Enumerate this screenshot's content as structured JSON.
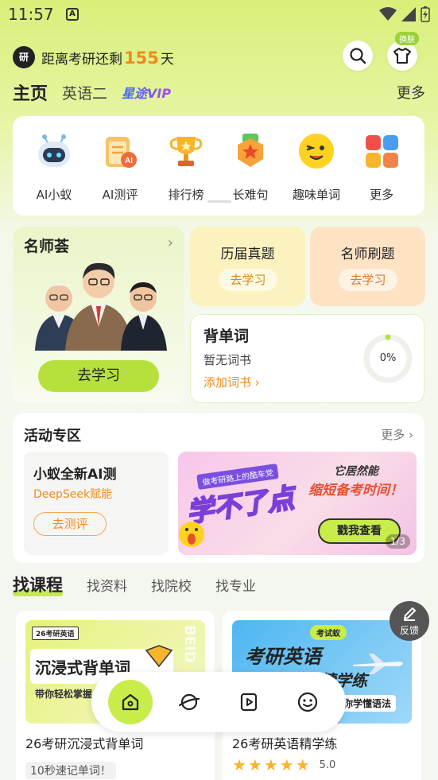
{
  "status_bar": {
    "time": "11:57",
    "badge": "A"
  },
  "header": {
    "logo_text": "研",
    "countdown_prefix": "距离考研还剩",
    "countdown_days": "155",
    "countdown_suffix": "天",
    "skin_label": "换肤"
  },
  "top_tabs": {
    "items": [
      "主页",
      "英语二"
    ],
    "vip_label": "星途VIP",
    "more_label": "更多"
  },
  "tools": [
    {
      "label": "AI小蚁",
      "icon": "robot-icon"
    },
    {
      "label": "AI测评",
      "icon": "ai-clipboard-icon"
    },
    {
      "label": "排行榜",
      "icon": "trophy-icon"
    },
    {
      "label": "长难句",
      "icon": "star-badge-icon"
    },
    {
      "label": "趣味单词",
      "icon": "smiley-icon"
    },
    {
      "label": "更多",
      "icon": "grid-icon"
    }
  ],
  "teacher_card": {
    "title": "名师荟",
    "button": "去学习"
  },
  "past_papers": {
    "title": "历届真题",
    "button": "去学习"
  },
  "teacher_drills": {
    "title": "名师刷题",
    "button": "去学习"
  },
  "vocab": {
    "title": "背单词",
    "status": "暂无词书",
    "add_link": "添加词书",
    "progress_text": "0%",
    "progress": 0
  },
  "activity": {
    "title": "活动专区",
    "more": "更多",
    "ai_promo": {
      "title": "小蚁全新AI测",
      "subtitle": "DeepSeek赋能",
      "button": "去测评"
    },
    "banner": {
      "tag": "做考研路上的酷车党",
      "headline": "学不了点",
      "title": "它居然能",
      "subtitle": "缩短备考时间！",
      "button": "戳我查看",
      "page": "1/3"
    }
  },
  "find_tabs": [
    "找课程",
    "找资料",
    "找院校",
    "找专业"
  ],
  "courses": [
    {
      "image_tag": "26考研英语",
      "image_title": "沉浸式背单词",
      "image_subtitle": "带你轻松掌握",
      "image_side": "BEID",
      "name": "26考研沉浸式背单词",
      "tag": "10秒速记单词！"
    },
    {
      "image_brand": "考试蚁",
      "image_title": "考研英语",
      "image_title2": "精学练",
      "image_subtitle": "带你学懂语法",
      "name": "26考研英语精学练",
      "rating": "5.0"
    }
  ],
  "feedback_label": "反馈",
  "colors": {
    "accent_green": "#c8ec4a",
    "accent_orange": "#f08a1e"
  }
}
